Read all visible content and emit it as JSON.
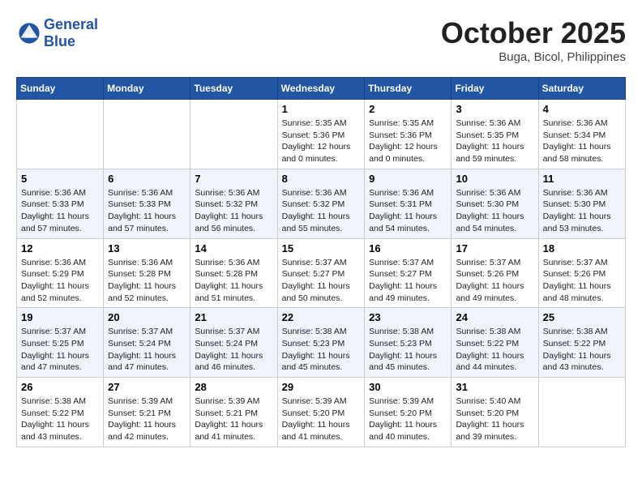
{
  "logo": {
    "line1": "General",
    "line2": "Blue"
  },
  "title": "October 2025",
  "location": "Buga, Bicol, Philippines",
  "days_of_week": [
    "Sunday",
    "Monday",
    "Tuesday",
    "Wednesday",
    "Thursday",
    "Friday",
    "Saturday"
  ],
  "weeks": [
    [
      {
        "day": "",
        "info": ""
      },
      {
        "day": "",
        "info": ""
      },
      {
        "day": "",
        "info": ""
      },
      {
        "day": "1",
        "info": "Sunrise: 5:35 AM\nSunset: 5:36 PM\nDaylight: 12 hours\nand 0 minutes."
      },
      {
        "day": "2",
        "info": "Sunrise: 5:35 AM\nSunset: 5:36 PM\nDaylight: 12 hours\nand 0 minutes."
      },
      {
        "day": "3",
        "info": "Sunrise: 5:36 AM\nSunset: 5:35 PM\nDaylight: 11 hours\nand 59 minutes."
      },
      {
        "day": "4",
        "info": "Sunrise: 5:36 AM\nSunset: 5:34 PM\nDaylight: 11 hours\nand 58 minutes."
      }
    ],
    [
      {
        "day": "5",
        "info": "Sunrise: 5:36 AM\nSunset: 5:33 PM\nDaylight: 11 hours\nand 57 minutes."
      },
      {
        "day": "6",
        "info": "Sunrise: 5:36 AM\nSunset: 5:33 PM\nDaylight: 11 hours\nand 57 minutes."
      },
      {
        "day": "7",
        "info": "Sunrise: 5:36 AM\nSunset: 5:32 PM\nDaylight: 11 hours\nand 56 minutes."
      },
      {
        "day": "8",
        "info": "Sunrise: 5:36 AM\nSunset: 5:32 PM\nDaylight: 11 hours\nand 55 minutes."
      },
      {
        "day": "9",
        "info": "Sunrise: 5:36 AM\nSunset: 5:31 PM\nDaylight: 11 hours\nand 54 minutes."
      },
      {
        "day": "10",
        "info": "Sunrise: 5:36 AM\nSunset: 5:30 PM\nDaylight: 11 hours\nand 54 minutes."
      },
      {
        "day": "11",
        "info": "Sunrise: 5:36 AM\nSunset: 5:30 PM\nDaylight: 11 hours\nand 53 minutes."
      }
    ],
    [
      {
        "day": "12",
        "info": "Sunrise: 5:36 AM\nSunset: 5:29 PM\nDaylight: 11 hours\nand 52 minutes."
      },
      {
        "day": "13",
        "info": "Sunrise: 5:36 AM\nSunset: 5:28 PM\nDaylight: 11 hours\nand 52 minutes."
      },
      {
        "day": "14",
        "info": "Sunrise: 5:36 AM\nSunset: 5:28 PM\nDaylight: 11 hours\nand 51 minutes."
      },
      {
        "day": "15",
        "info": "Sunrise: 5:37 AM\nSunset: 5:27 PM\nDaylight: 11 hours\nand 50 minutes."
      },
      {
        "day": "16",
        "info": "Sunrise: 5:37 AM\nSunset: 5:27 PM\nDaylight: 11 hours\nand 49 minutes."
      },
      {
        "day": "17",
        "info": "Sunrise: 5:37 AM\nSunset: 5:26 PM\nDaylight: 11 hours\nand 49 minutes."
      },
      {
        "day": "18",
        "info": "Sunrise: 5:37 AM\nSunset: 5:26 PM\nDaylight: 11 hours\nand 48 minutes."
      }
    ],
    [
      {
        "day": "19",
        "info": "Sunrise: 5:37 AM\nSunset: 5:25 PM\nDaylight: 11 hours\nand 47 minutes."
      },
      {
        "day": "20",
        "info": "Sunrise: 5:37 AM\nSunset: 5:24 PM\nDaylight: 11 hours\nand 47 minutes."
      },
      {
        "day": "21",
        "info": "Sunrise: 5:37 AM\nSunset: 5:24 PM\nDaylight: 11 hours\nand 46 minutes."
      },
      {
        "day": "22",
        "info": "Sunrise: 5:38 AM\nSunset: 5:23 PM\nDaylight: 11 hours\nand 45 minutes."
      },
      {
        "day": "23",
        "info": "Sunrise: 5:38 AM\nSunset: 5:23 PM\nDaylight: 11 hours\nand 45 minutes."
      },
      {
        "day": "24",
        "info": "Sunrise: 5:38 AM\nSunset: 5:22 PM\nDaylight: 11 hours\nand 44 minutes."
      },
      {
        "day": "25",
        "info": "Sunrise: 5:38 AM\nSunset: 5:22 PM\nDaylight: 11 hours\nand 43 minutes."
      }
    ],
    [
      {
        "day": "26",
        "info": "Sunrise: 5:38 AM\nSunset: 5:22 PM\nDaylight: 11 hours\nand 43 minutes."
      },
      {
        "day": "27",
        "info": "Sunrise: 5:39 AM\nSunset: 5:21 PM\nDaylight: 11 hours\nand 42 minutes."
      },
      {
        "day": "28",
        "info": "Sunrise: 5:39 AM\nSunset: 5:21 PM\nDaylight: 11 hours\nand 41 minutes."
      },
      {
        "day": "29",
        "info": "Sunrise: 5:39 AM\nSunset: 5:20 PM\nDaylight: 11 hours\nand 41 minutes."
      },
      {
        "day": "30",
        "info": "Sunrise: 5:39 AM\nSunset: 5:20 PM\nDaylight: 11 hours\nand 40 minutes."
      },
      {
        "day": "31",
        "info": "Sunrise: 5:40 AM\nSunset: 5:20 PM\nDaylight: 11 hours\nand 39 minutes."
      },
      {
        "day": "",
        "info": ""
      }
    ]
  ]
}
